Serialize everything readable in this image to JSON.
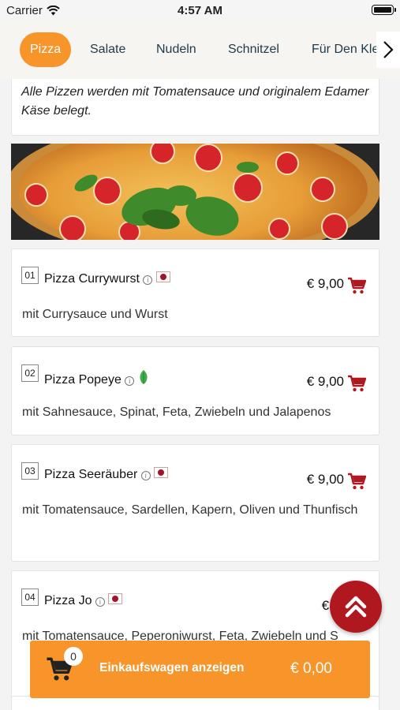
{
  "status_bar": {
    "carrier": "Carrier",
    "time": "4:57 AM"
  },
  "categories": [
    {
      "label": "Pizza",
      "active": true
    },
    {
      "label": "Salate"
    },
    {
      "label": "Nudeln"
    },
    {
      "label": "Schnitzel"
    },
    {
      "label": "Für Den Kle"
    }
  ],
  "intro_text": "Alle Pizzen werden mit Tomatensauce und originalem Edamer Käse belegt.",
  "items": [
    {
      "number": "01",
      "name": "Pizza Currywurst",
      "badge": "spicy-icon",
      "price": "€ 9,00",
      "description": "mit Currysauce und Wurst"
    },
    {
      "number": "02",
      "name": "Pizza Popeye",
      "badge": "vegetarian-leaf-icon",
      "price": "€ 9,00",
      "description": "mit Sahnesauce, Spinat, Feta, Zwiebeln und Jalapenos"
    },
    {
      "number": "03",
      "name": "Pizza Seeräuber",
      "badge": "spicy-icon",
      "price": "€ 9,00",
      "description": "mit Tomatensauce, Sardellen, Kapern, Oliven und Thunfisch"
    },
    {
      "number": "04",
      "name": "Pizza Jo",
      "badge": "spicy-icon",
      "price": "€ 9,",
      "description": "mit Tomatensauce, Peperoniwurst, Feta, Zwiebeln und S"
    }
  ],
  "cart": {
    "count": "0",
    "label": "Einkaufswagen anzeigen",
    "total": "€ 0,00"
  },
  "colors": {
    "accent": "#f7952b",
    "fab": "#b0171e",
    "cart_icon": "#b0171e"
  }
}
